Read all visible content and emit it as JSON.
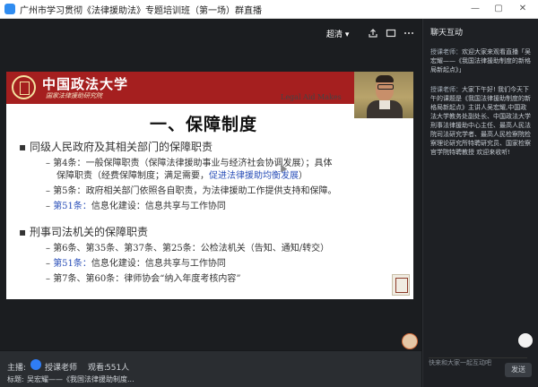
{
  "window": {
    "title": "广州市学习贯彻《法律援助法》专题培训班（第一场）群直播",
    "controls": [
      "—",
      "▢",
      "✕"
    ]
  },
  "video": {
    "clarity_label": "超清 ▾",
    "icons": [
      "share-icon",
      "popout-icon",
      "more-icon"
    ]
  },
  "slide": {
    "university": "中国政法大学",
    "institute": "国家法律援助研究院",
    "legal_aid_text": "Legal Aid Makes",
    "heading": "一、保障制度",
    "sections": [
      {
        "bullet": "同级人民政府及其相关部门的保障职责",
        "items": [
          {
            "prefix": "第4条：",
            "text": "一般保障职责（保障法律援助事业与经济社会协调发展）；具体"
          },
          {
            "prefix": "",
            "text": "保障职责（经费保障制度；满足需要，",
            "highlight": "促进法律援助均衡发展",
            "suffix": "）"
          },
          {
            "prefix": "第5条：",
            "text": "政府相关部门依照各自职责，为法律援助工作提供支持和保障。"
          },
          {
            "prefix": "第51条：",
            "text": "信息化建设：信息共享与工作协同",
            "prefix_blue": true
          }
        ]
      },
      {
        "bullet": "刑事司法机关的保障职责",
        "items": [
          {
            "prefix": "第6条、第35条、第37条、第25条：",
            "text": "公检法机关（告知、通知/转交）"
          },
          {
            "prefix": "第51条：",
            "text": "信息化建设：信息共享与工作协同",
            "prefix_blue": true
          },
          {
            "prefix": "第7条、第60条：",
            "text": "律师协会“纳入年度考核内容”"
          }
        ]
      }
    ]
  },
  "info": {
    "host_label": "主播:",
    "host_name": "授课老师",
    "viewers_label": "观看:",
    "viewers_count": "551人",
    "topic_label": "标题:",
    "topic_text": "吴宏耀——《我国法律援助制度..."
  },
  "chat": {
    "title": "聊天互动",
    "messages": [
      {
        "who": "授课老师：",
        "text": "欢迎大家来观看直播「吴宏耀——《我国法律援助制度的新格局新起点》」"
      },
      {
        "who": "授课老师：",
        "text": "大家下午好! 我们今天下午的课题是《我国法律援助制度的新格局新起点》主讲人吴宏耀,中国政法大学教务处副处长、中国政法大学刑事法律援助中心主任、最高人民法院司法研究学者、最高人民检察院检察理论研究所特聘研究员、国家检察官学院特聘教授 欢迎来收听!"
      }
    ],
    "input_placeholder": "快来和大家一起互动吧",
    "send_label": "发送"
  },
  "colors": {
    "banner": "#a51f1f",
    "accent_blue": "#2a4fb8",
    "panel": "#1e2024"
  }
}
